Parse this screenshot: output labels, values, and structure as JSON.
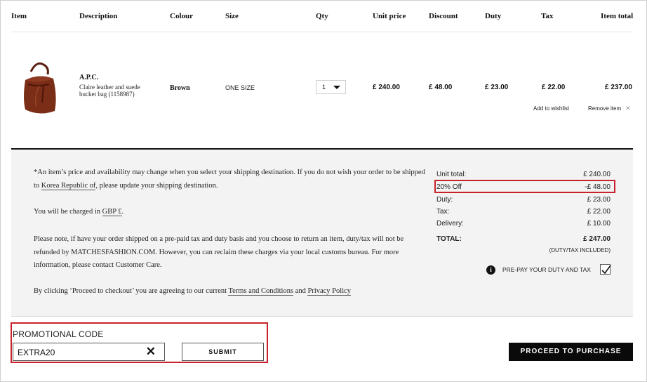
{
  "columns": {
    "item": "Item",
    "description": "Description",
    "colour": "Colour",
    "size": "Size",
    "qty": "Qty",
    "unit_price": "Unit price",
    "discount": "Discount",
    "duty": "Duty",
    "tax": "Tax",
    "item_total": "Item total"
  },
  "product": {
    "image_icon": "brown-bucket-bag",
    "brand": "A.P.C.",
    "description": "Claire leather and suede bucket bag (1158987)",
    "colour": "Brown",
    "size": "ONE SIZE",
    "qty": "1",
    "unit_price": "£ 240.00",
    "discount": "£ 48.00",
    "duty": "£ 23.00",
    "tax": "£ 22.00",
    "item_total": "£ 237.00",
    "add_to_wishlist": "Add to wishlist",
    "remove_item": "Remove item"
  },
  "notes": {
    "shipping_pre": "*An item’s price and availability may change when you select your shipping destination. If you do not wish your order to be shipped to ",
    "shipping_link": "Korea Republic of",
    "shipping_post": ", please update your shipping destination.",
    "charged_pre": "You will be charged in ",
    "charged_link": "GBP £",
    "charged_post": ".",
    "refund_text": "Please note, if have your order shipped on a pre-paid tax and duty basis and you choose to return an item, duty/tax will not be refunded by MATCHESFASHION.COM. However, you can reclaim these charges via your local customs bureau. For more information, please contact Customer Care.",
    "terms_pre": "By clicking ‘Proceed to checkout’ you are agreeing to our current ",
    "terms_link": "Terms and Conditions",
    "terms_mid": " and ",
    "privacy_link": "Privacy Policy"
  },
  "summary": {
    "unit_total_label": "Unit total:",
    "unit_total_value": "£ 240.00",
    "discount_label": "20% Off",
    "discount_value": "-£ 48.00",
    "duty_label": "Duty:",
    "duty_value": "£ 23.00",
    "tax_label": "Tax:",
    "tax_value": "£ 22.00",
    "delivery_label": "Delivery:",
    "delivery_value": "£ 10.00",
    "total_label": "TOTAL:",
    "total_value": "£ 247.00",
    "included_note": "(DUTY/TAX INCLUDED)",
    "prepay_label": "PRE-PAY YOUR DUTY AND TAX",
    "prepay_checked": true
  },
  "promo": {
    "label": "PROMOTIONAL CODE",
    "value": "EXTRA20",
    "submit_label": "SUBMIT"
  },
  "checkout_label": "PROCEED TO PURCHASE",
  "colors": {
    "highlight": "#c8232c",
    "panel_bg": "#f3f3f3",
    "button_bg": "#0a0a0a"
  }
}
